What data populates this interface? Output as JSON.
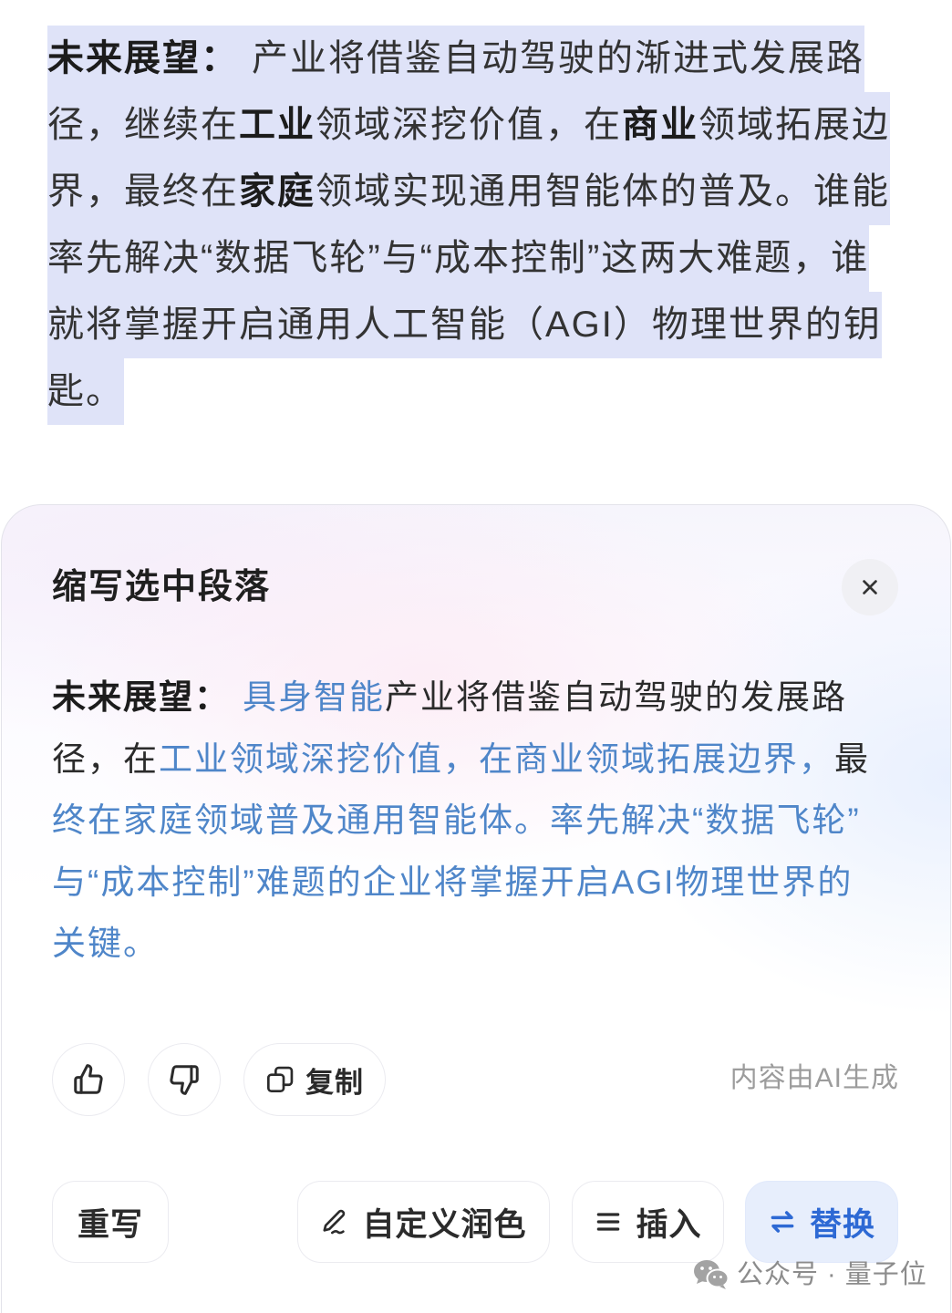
{
  "selected_text": {
    "lines": [
      [
        {
          "text": "未来展望：",
          "bold": true
        },
        {
          "text": "产业将借鉴自动驾驶的渐进式发展路"
        }
      ],
      [
        {
          "text": "径，继续在"
        },
        {
          "text": "工业",
          "bold": true
        },
        {
          "text": "领域深挖价值，在"
        },
        {
          "text": "商业",
          "bold": true
        },
        {
          "text": "领域拓展边"
        }
      ],
      [
        {
          "text": "界，最终在"
        },
        {
          "text": "家庭",
          "bold": true
        },
        {
          "text": "领域实现通用智能体的普及。谁能"
        }
      ],
      [
        {
          "text": "率先解决“数据飞轮”与“成本控制”这两大难题，谁"
        }
      ],
      [
        {
          "text": "就将掌握开启通用人工智能（AGI）物理世界的钥"
        }
      ],
      [
        {
          "text": "匙。"
        }
      ]
    ]
  },
  "panel": {
    "title": "缩写选中段落",
    "close_icon": "close-icon",
    "result_lines": [
      [
        {
          "text": "未来展望：",
          "bold": true
        },
        {
          "text": "具身智能",
          "changed": true
        },
        {
          "text": "产业将借鉴自动驾驶的发展路"
        }
      ],
      [
        {
          "text": "径，在"
        },
        {
          "text": "工业领域深挖价值，在商业领域拓展边界，",
          "changed": true
        },
        {
          "text": "最"
        }
      ],
      [
        {
          "text": "终在家庭领域普及通用智能体。率先解决“数据飞轮”",
          "changed": true
        }
      ],
      [
        {
          "text": "与“成本控制”难题的企业将掌握开启AGI物理世界的",
          "changed": true
        }
      ],
      [
        {
          "text": "关键。",
          "changed": true
        }
      ]
    ],
    "feedback": {
      "like_icon": "thumbs-up-icon",
      "dislike_icon": "thumbs-down-icon",
      "copy_icon": "copy-icon",
      "copy_label": "复制",
      "ai_notice": "内容由AI生成"
    },
    "actions": [
      {
        "label": "重写"
      },
      {
        "label": "自定义润色",
        "icon": "pen-icon"
      },
      {
        "label": "插入",
        "icon": "list-icon"
      },
      {
        "label": "替换",
        "icon": "swap-icon",
        "primary": true
      }
    ]
  },
  "watermark": {
    "icon": "wechat-icon",
    "text": "公众号 · 量子位"
  },
  "colors": {
    "selection_highlight": "#dfe3f8",
    "revised_text": "#4f86c9",
    "primary_action_bg": "#e7eefc",
    "primary_action_text": "#2d69d4",
    "muted_text": "#9c9c9c"
  }
}
